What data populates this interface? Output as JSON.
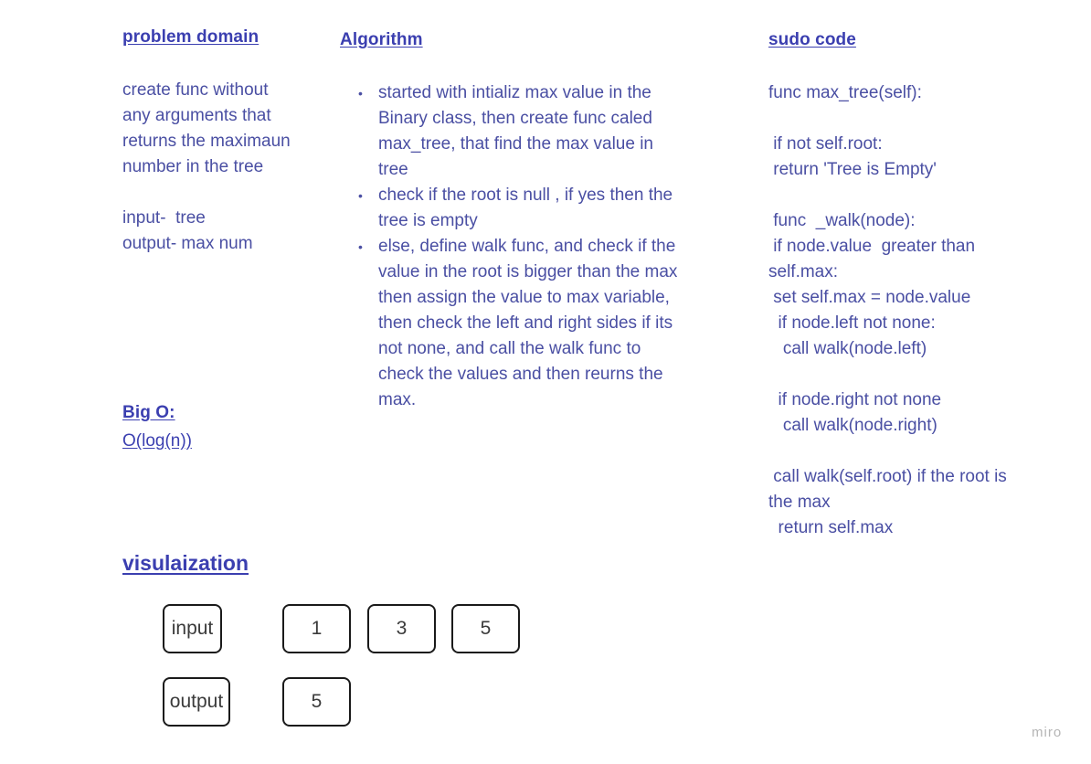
{
  "problem_domain": {
    "heading": "problem domain",
    "body": "create func without\nany arguments that\nreturns the maximaun\nnumber in the tree\n\ninput-  tree\noutput- max num"
  },
  "big_o": {
    "heading": "Big O:",
    "value": "O(log(n))"
  },
  "algorithm": {
    "heading": "Algorithm",
    "items": [
      "started with intializ max value in the\nBinary class, then create func caled\nmax_tree, that find the max value in\ntree",
      "check if the root is null , if yes then the\ntree is empty",
      "else, define walk func, and check if the\nvalue in the root is bigger than the max\nthen assign the value to max variable,\nthen check the left and right sides if its\nnot none, and call the walk func to\ncheck the values and then reurns the\nmax."
    ]
  },
  "sudo_code": {
    "heading": "sudo code",
    "body": "func max_tree(self):\n\n if not self.root:\n return 'Tree is Empty'\n\n func  _walk(node):\n if node.value  greater than\nself.max:\n set self.max = node.value\n  if node.left not none:\n   call walk(node.left)\n\n  if node.right not none\n   call walk(node.right)\n\n call walk(self.root) if the root is\nthe max\n  return self.max"
  },
  "visualization": {
    "heading": "visulaization",
    "input_label": "input",
    "input_values": [
      "1",
      "3",
      "5"
    ],
    "output_label": "output",
    "output_values": [
      "5"
    ]
  },
  "branding": {
    "logo_text": "miro"
  }
}
